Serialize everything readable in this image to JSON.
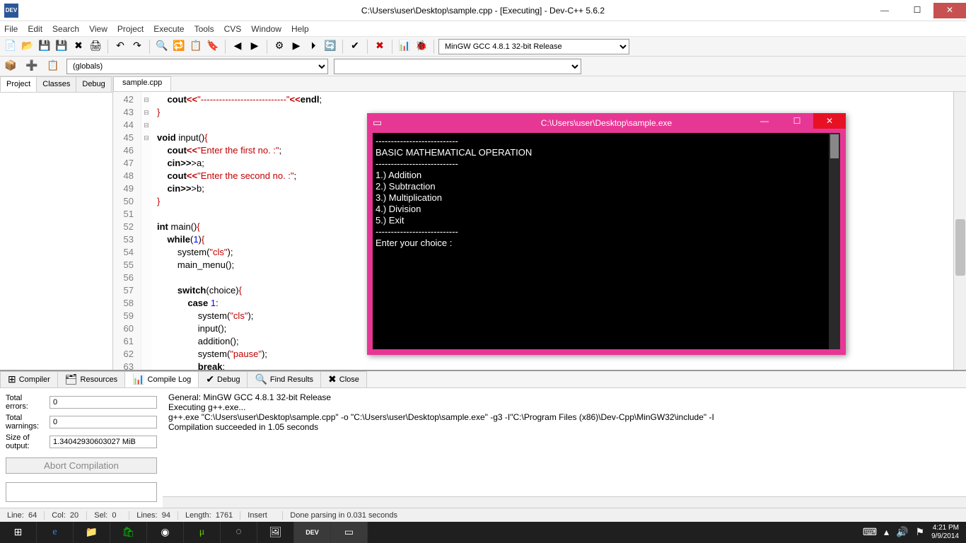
{
  "window": {
    "title": "C:\\Users\\user\\Desktop\\sample.cpp - [Executing] - Dev-C++ 5.6.2",
    "app_icon_label": "DEV"
  },
  "menu": [
    "File",
    "Edit",
    "Search",
    "View",
    "Project",
    "Execute",
    "Tools",
    "CVS",
    "Window",
    "Help"
  ],
  "toolbar": {
    "compiler_combo": "MinGW GCC 4.8.1 32-bit Release",
    "scope_combo": "(globals)"
  },
  "left_tabs": [
    "Project",
    "Classes",
    "Debug"
  ],
  "file_tab": "sample.cpp",
  "code": {
    "first_line": 42,
    "lines": [
      {
        "n": 42,
        "t": "    cout<<\"----------------------------\"<<endl;"
      },
      {
        "n": 43,
        "t": "}"
      },
      {
        "n": 44,
        "t": ""
      },
      {
        "n": 45,
        "t": "void input(){",
        "fold": "-"
      },
      {
        "n": 46,
        "t": "    cout<<\"Enter the first no. :\";"
      },
      {
        "n": 47,
        "t": "    cin>>a;"
      },
      {
        "n": 48,
        "t": "    cout<<\"Enter the second no. :\";"
      },
      {
        "n": 49,
        "t": "    cin>>b;"
      },
      {
        "n": 50,
        "t": "}"
      },
      {
        "n": 51,
        "t": ""
      },
      {
        "n": 52,
        "t": "int main(){",
        "fold": "-"
      },
      {
        "n": 53,
        "t": "    while(1){",
        "fold": "-"
      },
      {
        "n": 54,
        "t": "        system(\"cls\");"
      },
      {
        "n": 55,
        "t": "        main_menu();"
      },
      {
        "n": 56,
        "t": ""
      },
      {
        "n": 57,
        "t": "        switch(choice){",
        "fold": "-"
      },
      {
        "n": 58,
        "t": "            case 1:"
      },
      {
        "n": 59,
        "t": "                system(\"cls\");"
      },
      {
        "n": 60,
        "t": "                input();"
      },
      {
        "n": 61,
        "t": "                addition();"
      },
      {
        "n": 62,
        "t": "                system(\"pause\");"
      },
      {
        "n": 63,
        "t": "                break;"
      }
    ]
  },
  "bottom_tabs": [
    "Compiler",
    "Resources",
    "Compile Log",
    "Debug",
    "Find Results",
    "Close"
  ],
  "compile_panel": {
    "total_errors_label": "Total errors:",
    "total_errors": "0",
    "total_warnings_label": "Total warnings:",
    "total_warnings": "0",
    "size_label": "Size of output:",
    "size": "1.34042930603027 MiB",
    "abort": "Abort Compilation"
  },
  "compile_log": "General: MinGW GCC 4.8.1 32-bit Release\nExecuting g++.exe...\ng++.exe \"C:\\Users\\user\\Desktop\\sample.cpp\" -o \"C:\\Users\\user\\Desktop\\sample.exe\" -g3 -I\"C:\\Program Files (x86)\\Dev-Cpp\\MinGW32\\include\" -I\nCompilation succeeded in 1.05 seconds",
  "status": {
    "line_label": "Line:",
    "line": "64",
    "col_label": "Col:",
    "col": "20",
    "sel_label": "Sel:",
    "sel": "0",
    "lines_label": "Lines:",
    "lines": "94",
    "length_label": "Length:",
    "length": "1761",
    "mode": "Insert",
    "parse": "Done parsing in 0.031 seconds"
  },
  "console": {
    "title": "C:\\Users\\user\\Desktop\\sample.exe",
    "body": "---------------------------\nBASIC MATHEMATICAL OPERATION\n---------------------------\n1.) Addition\n2.) Subtraction\n3.) Multiplication\n4.) Division\n5.) Exit\n---------------------------\nEnter your choice :"
  },
  "taskbar": {
    "time": "4:21 PM",
    "date": "9/9/2014"
  }
}
